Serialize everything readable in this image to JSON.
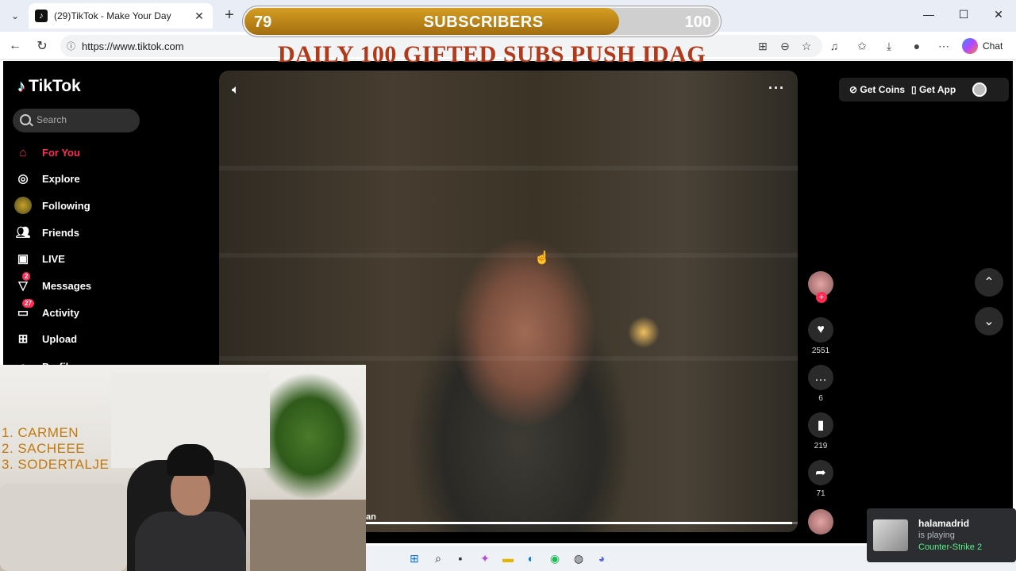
{
  "browser": {
    "tab_title": "(29)TikTok - Make Your Day",
    "url": "https://www.tiktok.com",
    "chat_label": "Chat"
  },
  "stream_overlay": {
    "current": "79",
    "label": "SUBSCRIBERS",
    "goal": "100",
    "progress": 0.79,
    "banner": "DAILY 100  GIFTED SUBS PUSH IDAG",
    "leaderboard": [
      "1.  CARMEN",
      "2.  SACHEEE",
      "3.  SODERTALJE"
    ]
  },
  "tiktok": {
    "logo": "TikTok",
    "search_placeholder": "Search",
    "nav": [
      {
        "label": "For You",
        "icon": "home-icon",
        "active": true
      },
      {
        "label": "Explore",
        "icon": "compass-icon"
      },
      {
        "label": "Following",
        "icon": "following-avatar-icon"
      },
      {
        "label": "Friends",
        "icon": "friends-icon"
      },
      {
        "label": "LIVE",
        "icon": "live-icon"
      },
      {
        "label": "Messages",
        "icon": "messages-icon",
        "badge": "2"
      },
      {
        "label": "Activity",
        "icon": "activity-icon",
        "badge": "27"
      },
      {
        "label": "Upload",
        "icon": "upload-icon"
      },
      {
        "label": "Profile",
        "icon": "profile-icon"
      }
    ],
    "get_coins": "Get Coins",
    "get_app": "Get App",
    "likes": "2551",
    "comments": "6",
    "saves": "219",
    "shares": "71",
    "video_caption_fragment": "an",
    "video_progress": 0.99
  },
  "discord_toast": {
    "user": "halamadrid",
    "status": "is playing",
    "game": "Counter-Strike 2"
  },
  "colors": {
    "accent": "#fe2c55",
    "progress_gold": "#c08a18",
    "banner_red": "#b03a1a",
    "rank_orange": "#c27a10"
  }
}
